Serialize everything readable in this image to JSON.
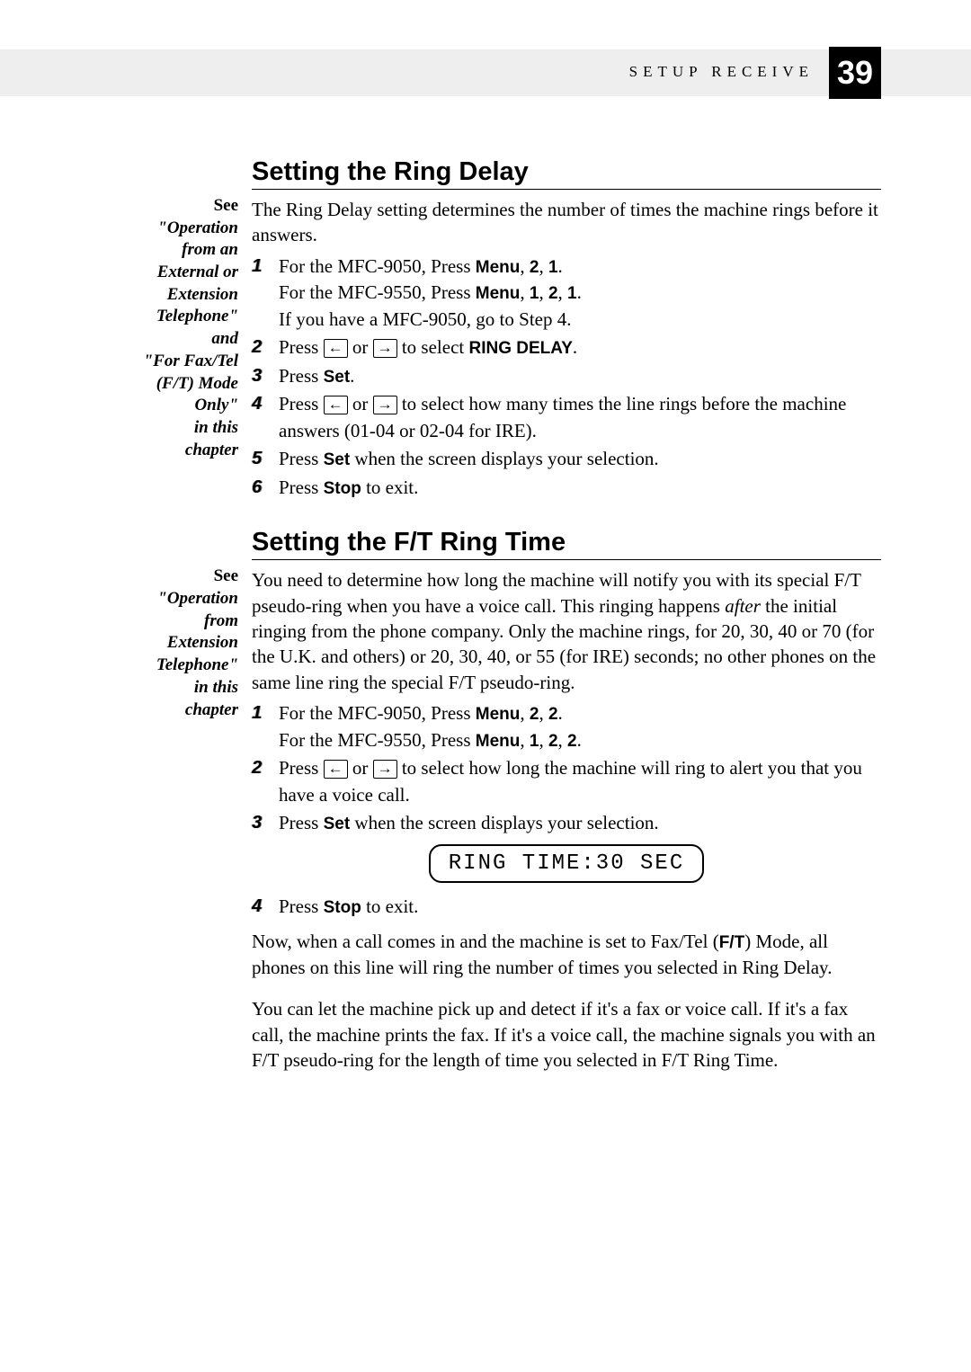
{
  "header": {
    "section": "SETUP RECEIVE",
    "page_number": "39"
  },
  "section1": {
    "title": "Setting the Ring Delay",
    "margin_note": "See \"Operation from an External or Extension Telephone\" and \"For Fax/Tel (F/T) Mode Only\" in this chapter",
    "intro": "The Ring Delay setting determines the number of times the machine rings before it answers.",
    "steps": [
      {
        "n": "1",
        "text_a": "For the MFC-9050, Press ",
        "b1": "Menu",
        "mid1": ", ",
        "b2": "2",
        "mid2": ", ",
        "b3": "1",
        "tail1": ".",
        "line2_a": "For the MFC-9550, Press ",
        "l2b1": "Menu",
        "l2m1": ", ",
        "l2b2": "1",
        "l2m2": ", ",
        "l2b3": "2",
        "l2m3": ", ",
        "l2b4": "1",
        "l2tail": ".",
        "line3": "If you have a MFC-9050, go to Step 4."
      },
      {
        "n": "2",
        "pre": "Press ",
        "or": " or ",
        "post": " to select ",
        "target": "RING DELAY",
        "end": "."
      },
      {
        "n": "3",
        "pre": "Press ",
        "b": "Set",
        "end": "."
      },
      {
        "n": "4",
        "pre": "Press ",
        "or": " or ",
        "post": " to select how many times the line rings before the machine answers (01-04 or 02-04 for IRE)."
      },
      {
        "n": "5",
        "pre": "Press ",
        "b": "Set",
        "post": " when the screen displays your selection."
      },
      {
        "n": "6",
        "pre": "Press ",
        "b": "Stop",
        "post": " to exit."
      }
    ]
  },
  "section2": {
    "title": "Setting the F/T Ring Time",
    "margin_note": "See \"Operation from Extension Telephone\" in this chapter",
    "intro_a": "You need to determine how long the machine will notify you with its special F/T pseudo-ring when you have a voice call. This ringing happens ",
    "intro_it": "after",
    "intro_b": " the initial ringing from the phone company. Only the machine rings, for 20, 30, 40 or 70 (for the U.K. and others) or 20, 30, 40, or 55 (for IRE) seconds; no other phones on the same line ring the special F/T pseudo-ring.",
    "steps": [
      {
        "n": "1",
        "text_a": "For the MFC-9050, Press ",
        "b1": "Menu",
        "m1": ", ",
        "b2": "2",
        "m2": ", ",
        "b3": "2",
        "tail": ".",
        "line2_a": "For the MFC-9550, Press ",
        "l2b1": "Menu",
        "l2m1": ", ",
        "l2b2": "1",
        "l2m2": ", ",
        "l2b3": "2",
        "l2m3": ", ",
        "l2b4": "2",
        "l2tail": "."
      },
      {
        "n": "2",
        "pre": "Press ",
        "or": " or ",
        "post": " to select how long the machine will ring to alert you that you have a voice call."
      },
      {
        "n": "3",
        "pre": "Press ",
        "b": "Set",
        "post": " when the screen displays your selection."
      }
    ],
    "lcd": "RING TIME:30 SEC",
    "step4": {
      "n": "4",
      "pre": "Press ",
      "b": "Stop",
      "post": " to exit."
    },
    "para2_a": "Now, when a call comes in and the machine is set to Fax/Tel (",
    "para2_b": "F/T",
    "para2_c": ") Mode, all phones on this line will ring the number of times you selected in Ring Delay.",
    "para3": "You can let the machine pick up and detect if it's a fax or voice call. If it's a fax call, the machine prints the fax. If it's a voice call, the machine signals you with an F/T pseudo-ring for the length of time you selected in F/T Ring Time."
  },
  "keys": {
    "left": "←",
    "right": "→"
  }
}
